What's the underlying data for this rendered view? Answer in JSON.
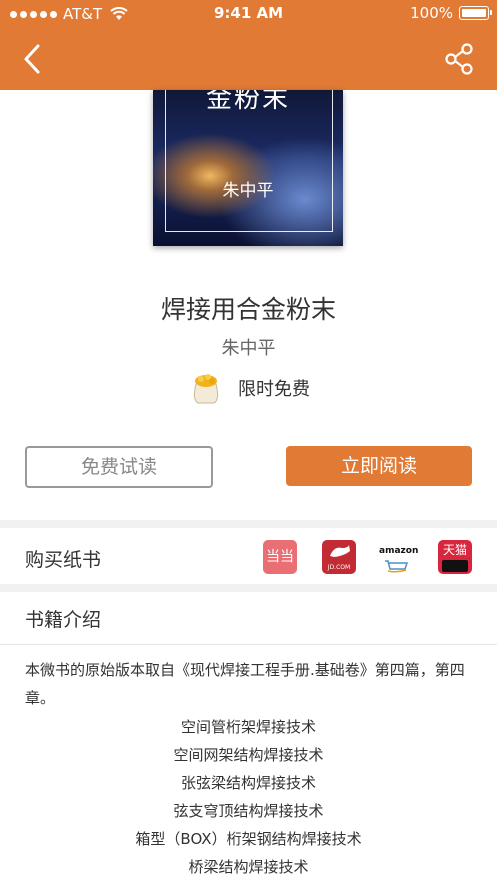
{
  "status_bar": {
    "carrier": "AT&T",
    "time": "9:41 AM",
    "battery": "100%"
  },
  "nav": {
    "back_icon": "chevron-left-icon",
    "share_icon": "share-icon"
  },
  "cover": {
    "title": "金粉末",
    "author": "朱中平"
  },
  "book": {
    "title": "焊接用合金粉末",
    "author": "朱中平",
    "promo": "限时免费"
  },
  "actions": {
    "trial": "免费试读",
    "read": "立即阅读"
  },
  "purchase": {
    "title": "购买纸书",
    "stores": [
      {
        "name": "当当",
        "label": "当当"
      },
      {
        "name": "京东",
        "label": "JD.COM"
      },
      {
        "name": "amazon",
        "label": "amazon"
      },
      {
        "name": "天猫",
        "label": "天猫"
      }
    ]
  },
  "intro": {
    "title": "书籍介绍",
    "paragraph": "本微书的原始版本取自《现代焊接工程手册.基础卷》第四篇，第四章。",
    "items": [
      "空间管桁架焊接技术",
      "空间网架结构焊接技术",
      "张弦梁结构焊接技术",
      "弦支穹顶结构焊接技术",
      "箱型（BOX）桁架钢结构焊接技术",
      "桥梁结构焊接技术"
    ]
  },
  "colors": {
    "accent": "#E07A35",
    "divider": "#f1f1f1"
  }
}
